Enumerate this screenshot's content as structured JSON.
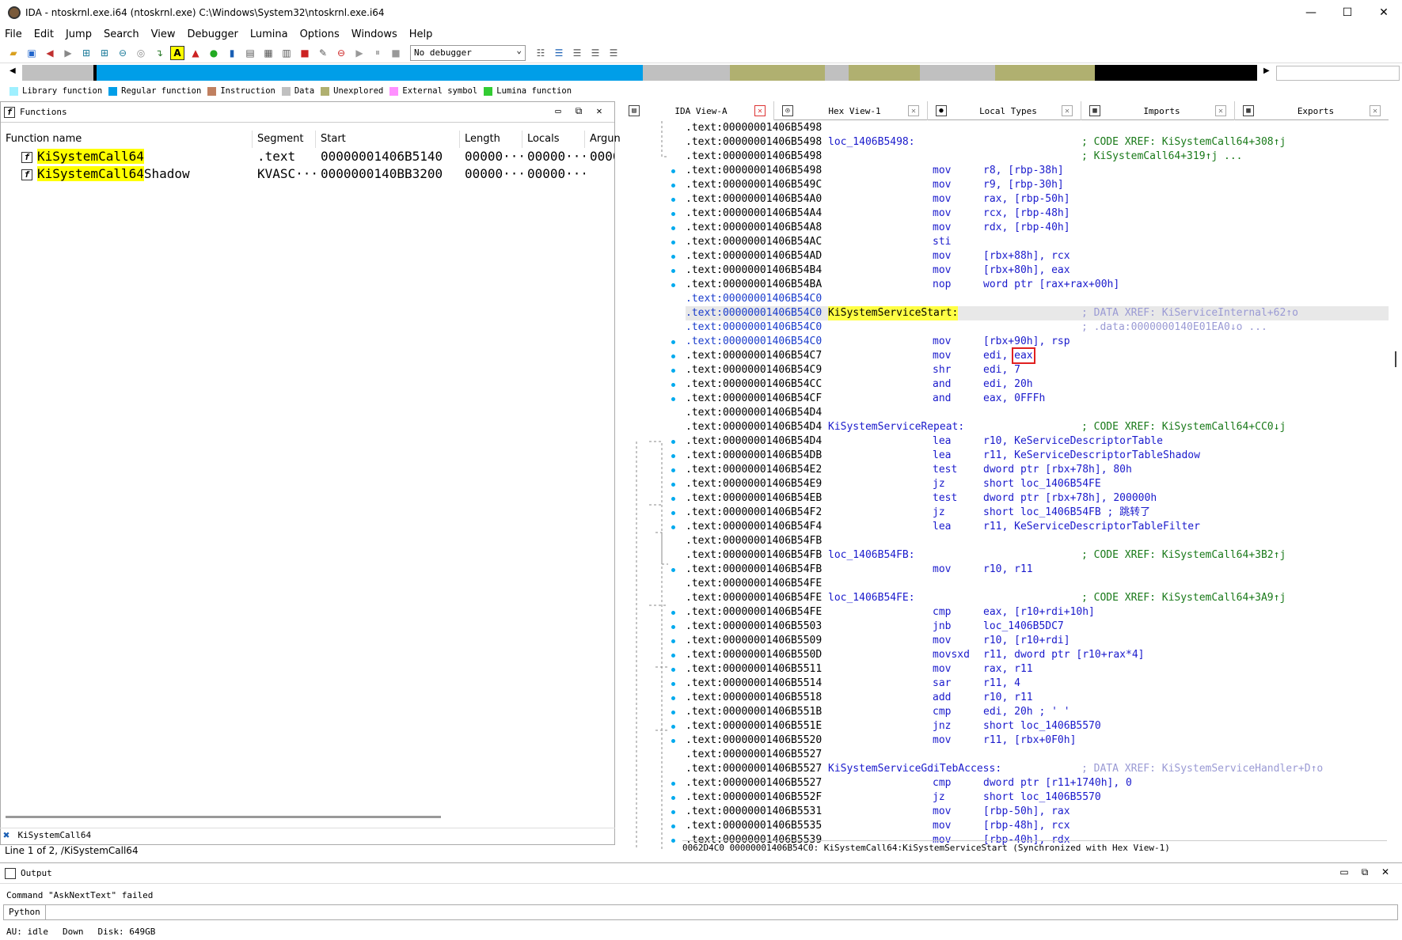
{
  "window": {
    "title": "IDA - ntoskrnl.exe.i64 (ntoskrnl.exe) C:\\Windows\\System32\\ntoskrnl.exe.i64",
    "min": "—",
    "max": "☐",
    "close": "✕"
  },
  "menu": [
    "File",
    "Edit",
    "Jump",
    "Search",
    "View",
    "Debugger",
    "Lumina",
    "Options",
    "Windows",
    "Help"
  ],
  "toolbar": {
    "debugger_select": "No debugger"
  },
  "legend": [
    {
      "label": "Library function",
      "color": "#9ff0ff"
    },
    {
      "label": "Regular function",
      "color": "#009ee8"
    },
    {
      "label": "Instruction",
      "color": "#c08060"
    },
    {
      "label": "Data",
      "color": "#c0c0c0"
    },
    {
      "label": "Unexplored",
      "color": "#b0b070"
    },
    {
      "label": "External symbol",
      "color": "#ff90ff"
    },
    {
      "label": "Lumina function",
      "color": "#33cc33"
    }
  ],
  "functions_panel": {
    "title": "Functions",
    "columns": [
      "Function name",
      "Segment",
      "Start",
      "Length",
      "Locals",
      "Argun"
    ],
    "rows": [
      {
        "name_hl": "KiSystemCall64",
        "name_rest": "",
        "segment": ".text",
        "start": "00000001406B5140",
        "length": "00000···",
        "locals": "00000···",
        "args": "0000"
      },
      {
        "name_hl": "KiSystemCall64",
        "name_rest": "Shadow",
        "segment": "KVASC···",
        "start": "0000000140BB3200",
        "length": "00000···",
        "locals": "00000···",
        "args": ""
      }
    ],
    "filter_text": "KiSystemCall64",
    "line_status": "Line 1 of 2, /KiSystemCall64"
  },
  "tabs": [
    {
      "label": "IDA View-A",
      "icon": "ida-view-icon"
    },
    {
      "label": "Hex View-1",
      "icon": "hex-view-icon"
    },
    {
      "label": "Local Types",
      "icon": "local-types-icon"
    },
    {
      "label": "Imports",
      "icon": "imports-icon"
    },
    {
      "label": "Exports",
      "icon": "exports-icon"
    }
  ],
  "disasm": [
    {
      "addr": ".text:00000001406B5498"
    },
    {
      "addr": ".text:00000001406B5498",
      "label": "loc_1406B5498:",
      "comment": "; CODE XREF: KiSystemCall64+308↑j"
    },
    {
      "addr": ".text:00000001406B5498",
      "comment": "; KiSystemCall64+319↑j ..."
    },
    {
      "addr": ".text:00000001406B5498",
      "mn": "mov",
      "op": "r8, [rbp-38h]"
    },
    {
      "addr": ".text:00000001406B549C",
      "mn": "mov",
      "op": "r9, [rbp-30h]"
    },
    {
      "addr": ".text:00000001406B54A0",
      "mn": "mov",
      "op": "rax, [rbp-50h]"
    },
    {
      "addr": ".text:00000001406B54A4",
      "mn": "mov",
      "op": "rcx, [rbp-48h]"
    },
    {
      "addr": ".text:00000001406B54A8",
      "mn": "mov",
      "op": "rdx, [rbp-40h]"
    },
    {
      "addr": ".text:00000001406B54AC",
      "mn": "sti",
      "op": ""
    },
    {
      "addr": ".text:00000001406B54AD",
      "mn": "mov",
      "op": "[rbx+88h], rcx"
    },
    {
      "addr": ".text:00000001406B54B4",
      "mn": "mov",
      "op": "[rbx+80h], eax"
    },
    {
      "addr": ".text:00000001406B54BA",
      "mn": "nop",
      "op": "word ptr [rax+rax+00h]"
    },
    {
      "addr": ".text:00000001406B54C0",
      "blue": true
    },
    {
      "addr": ".text:00000001406B54C0",
      "blue": true,
      "label": "KiSystemServiceStart:",
      "hl": true,
      "comment": "; DATA XREF: KiServiceInternal+62↑o",
      "gray": true,
      "sel": true
    },
    {
      "addr": ".text:00000001406B54C0",
      "blue": true,
      "comment": "; .data:0000000140E01EA0↓o ...",
      "gray": true
    },
    {
      "addr": ".text:00000001406B54C0",
      "blue": true,
      "mn": "mov",
      "op": "[rbx+90h], rsp"
    },
    {
      "addr": ".text:00000001406B54C7",
      "mn": "mov",
      "op": "edi, ",
      "boxed": "eax"
    },
    {
      "addr": ".text:00000001406B54C9",
      "mn": "shr",
      "op": "edi, 7"
    },
    {
      "addr": ".text:00000001406B54CC",
      "mn": "and",
      "op": "edi, 20h"
    },
    {
      "addr": ".text:00000001406B54CF",
      "mn": "and",
      "op": "eax, 0FFFh"
    },
    {
      "addr": ".text:00000001406B54D4"
    },
    {
      "addr": ".text:00000001406B54D4",
      "label": "KiSystemServiceRepeat:",
      "comment": "; CODE XREF: KiSystemCall64+CC0↓j"
    },
    {
      "addr": ".text:00000001406B54D4",
      "mn": "lea",
      "op": "r10, KeServiceDescriptorTable"
    },
    {
      "addr": ".text:00000001406B54DB",
      "mn": "lea",
      "op": "r11, KeServiceDescriptorTableShadow"
    },
    {
      "addr": ".text:00000001406B54E2",
      "mn": "test",
      "op": "dword ptr [rbx+78h], 80h"
    },
    {
      "addr": ".text:00000001406B54E9",
      "mn": "jz",
      "op": "short loc_1406B54FE"
    },
    {
      "addr": ".text:00000001406B54EB",
      "mn": "test",
      "op": "dword ptr [rbx+78h], 200000h"
    },
    {
      "addr": ".text:00000001406B54F2",
      "mn": "jz",
      "op": "short loc_1406B54FB ; 跳转了"
    },
    {
      "addr": ".text:00000001406B54F4",
      "mn": "lea",
      "op": "r11, KeServiceDescriptorTableFilter"
    },
    {
      "addr": ".text:00000001406B54FB"
    },
    {
      "addr": ".text:00000001406B54FB",
      "label": "loc_1406B54FB:",
      "comment": "; CODE XREF: KiSystemCall64+3B2↑j"
    },
    {
      "addr": ".text:00000001406B54FB",
      "mn": "mov",
      "op": "r10, r11"
    },
    {
      "addr": ".text:00000001406B54FE"
    },
    {
      "addr": ".text:00000001406B54FE",
      "label": "loc_1406B54FE:",
      "comment": "; CODE XREF: KiSystemCall64+3A9↑j"
    },
    {
      "addr": ".text:00000001406B54FE",
      "mn": "cmp",
      "op": "eax, [r10+rdi+10h]"
    },
    {
      "addr": ".text:00000001406B5503",
      "mn": "jnb",
      "op": "loc_1406B5DC7"
    },
    {
      "addr": ".text:00000001406B5509",
      "mn": "mov",
      "op": "r10, [r10+rdi]"
    },
    {
      "addr": ".text:00000001406B550D",
      "mn": "movsxd",
      "op": "r11, dword ptr [r10+rax*4]"
    },
    {
      "addr": ".text:00000001406B5511",
      "mn": "mov",
      "op": "rax, r11"
    },
    {
      "addr": ".text:00000001406B5514",
      "mn": "sar",
      "op": "r11, 4"
    },
    {
      "addr": ".text:00000001406B5518",
      "mn": "add",
      "op": "r10, r11"
    },
    {
      "addr": ".text:00000001406B551B",
      "mn": "cmp",
      "op": "edi, 20h ; ' '"
    },
    {
      "addr": ".text:00000001406B551E",
      "mn": "jnz",
      "op": "short loc_1406B5570"
    },
    {
      "addr": ".text:00000001406B5520",
      "mn": "mov",
      "op": "r11, [rbx+0F0h]"
    },
    {
      "addr": ".text:00000001406B5527"
    },
    {
      "addr": ".text:00000001406B5527",
      "label": "KiSystemServiceGdiTebAccess:",
      "comment": "; DATA XREF: KiSystemServiceHandler+D↑o",
      "gray": true
    },
    {
      "addr": ".text:00000001406B5527",
      "mn": "cmp",
      "op": "dword ptr [r11+1740h], 0"
    },
    {
      "addr": ".text:00000001406B552F",
      "mn": "jz",
      "op": "short loc_1406B5570"
    },
    {
      "addr": ".text:00000001406B5531",
      "mn": "mov",
      "op": "[rbp-50h], rax"
    },
    {
      "addr": ".text:00000001406B5535",
      "mn": "mov",
      "op": "[rbp-48h], rcx"
    },
    {
      "addr": ".text:00000001406B5539",
      "mn": "mov",
      "op": "[rbp-40h], rdx"
    }
  ],
  "sync_status": "0062D4C0 00000001406B54C0: KiSystemCall64:KiSystemServiceStart (Synchronized with Hex View-1)",
  "output": {
    "title": "Output",
    "text": "Command \"AskNextText\" failed",
    "lang": "Python",
    "status": [
      "AU:  idle",
      "Down",
      "Disk: 649GB"
    ]
  }
}
